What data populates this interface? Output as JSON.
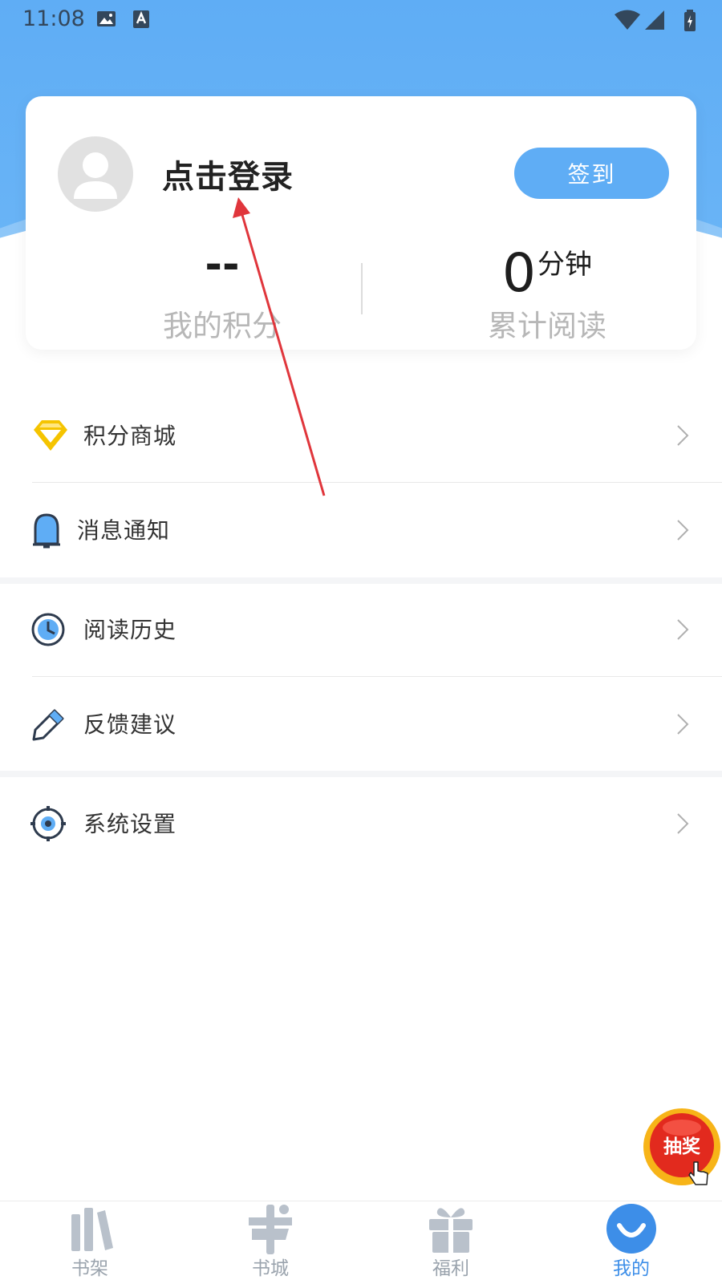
{
  "status_bar": {
    "time": "11:08"
  },
  "profile": {
    "login_text": "点击登录",
    "signin_label": "签到"
  },
  "stats": {
    "points_value": "--",
    "points_label": "我的积分",
    "reading_value": "0",
    "reading_unit": "分钟",
    "reading_label": "累计阅读"
  },
  "menu": {
    "items": [
      {
        "label": "积分商城",
        "icon": "diamond-icon"
      },
      {
        "label": "消息通知",
        "icon": "bell-icon"
      },
      {
        "label": "阅读历史",
        "icon": "clock-icon"
      },
      {
        "label": "反馈建议",
        "icon": "pencil-icon"
      },
      {
        "label": "系统设置",
        "icon": "settings-icon"
      }
    ]
  },
  "float_button": {
    "label": "抽奖"
  },
  "tabbar": {
    "items": [
      {
        "label": "书架",
        "icon": "bookshelf-icon"
      },
      {
        "label": "书城",
        "icon": "bookstore-icon"
      },
      {
        "label": "福利",
        "icon": "gift-icon"
      },
      {
        "label": "我的",
        "icon": "profile-icon"
      }
    ],
    "active_index": 3
  },
  "colors": {
    "accent": "#5fadf5",
    "active_tab": "#3d8ee8",
    "inactive_tab": "#9aa3ad",
    "diamond": "#f5c400",
    "annotation_arrow": "#e0363c"
  }
}
